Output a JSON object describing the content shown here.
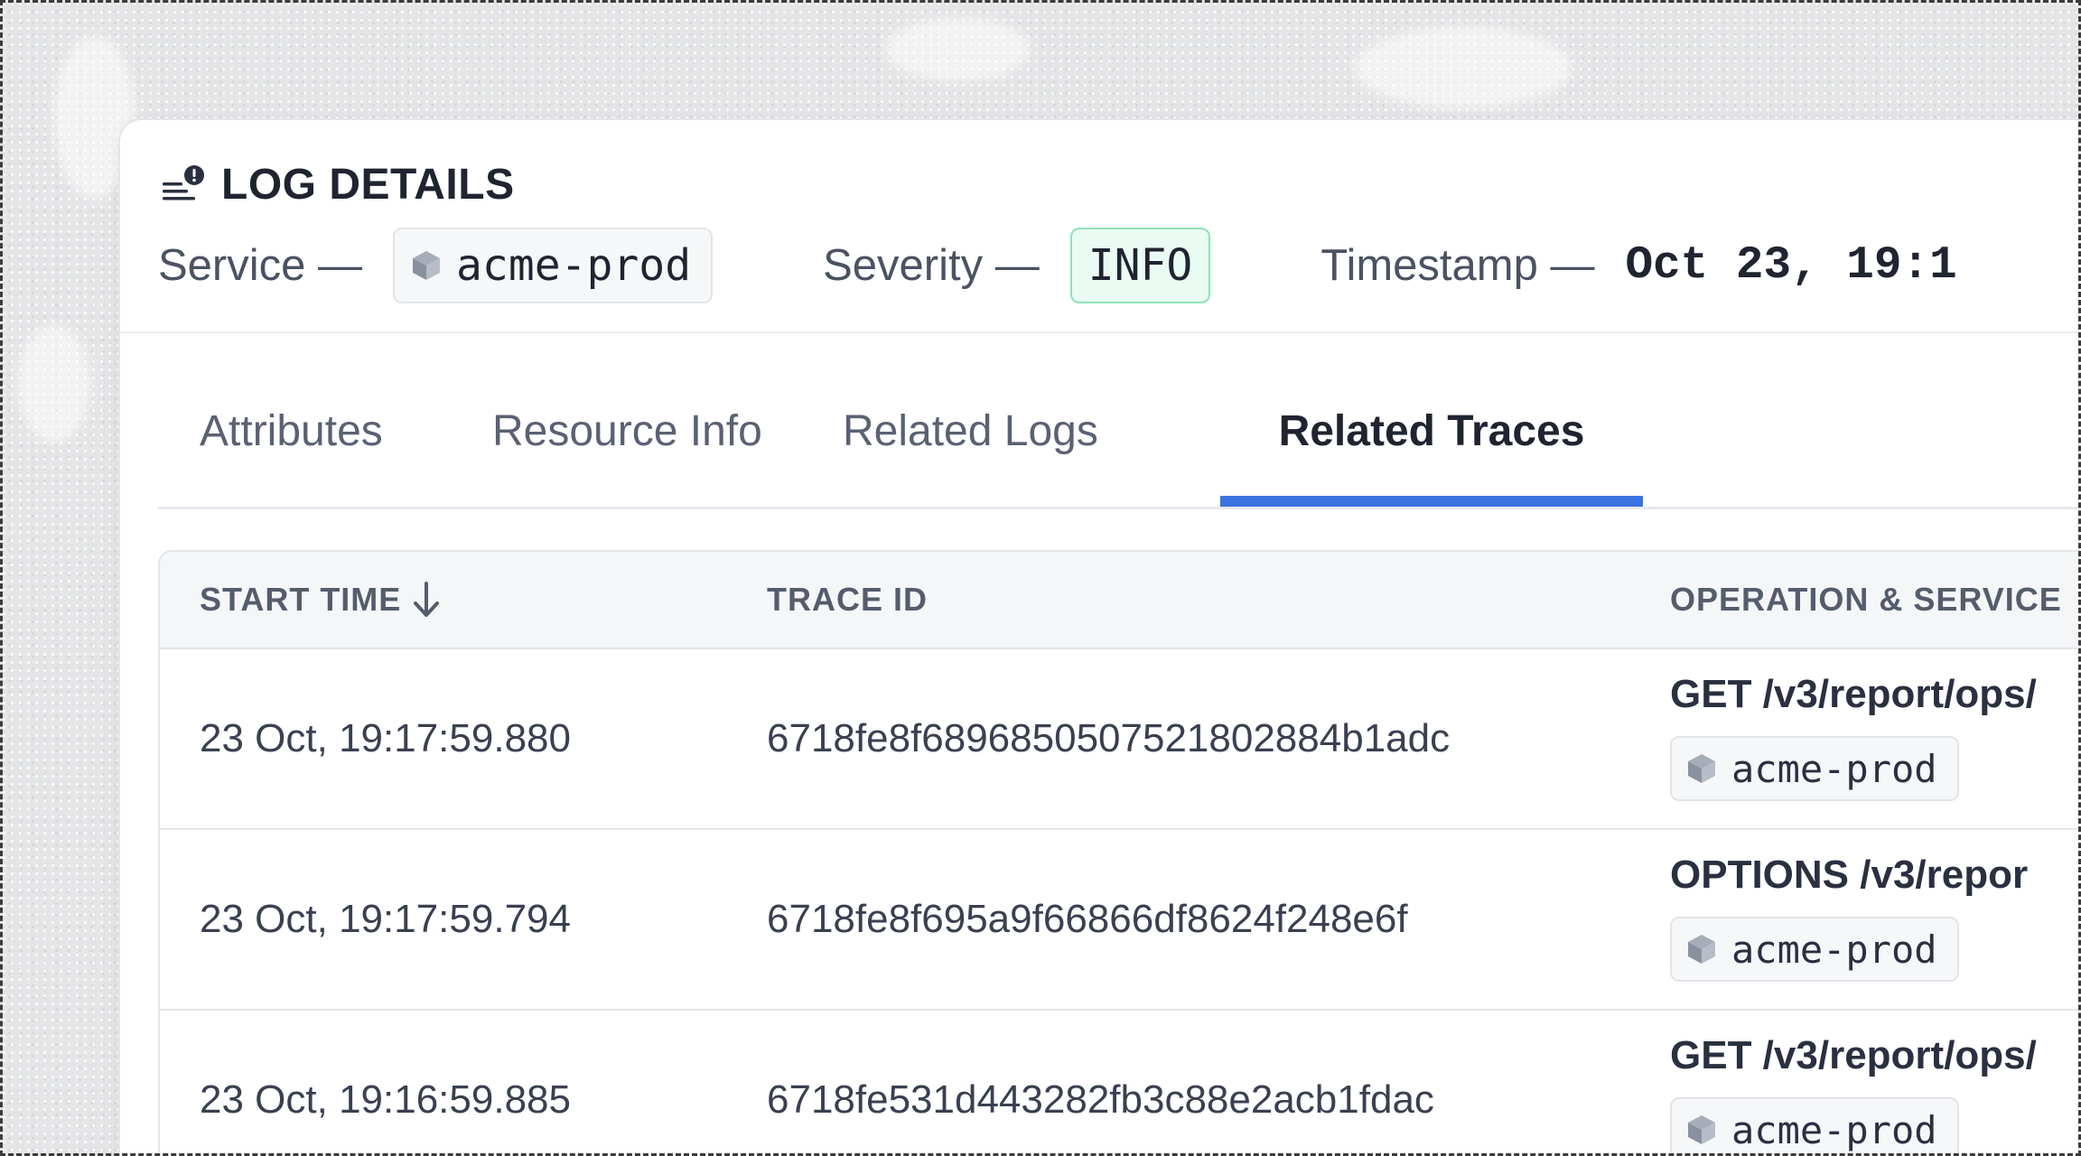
{
  "header": {
    "title": "LOG DETAILS",
    "service_label": "Service —",
    "service_value": "acme-prod",
    "severity_label": "Severity —",
    "severity_value": "INFO",
    "timestamp_label": "Timestamp —",
    "timestamp_value": "Oct 23, 19:1"
  },
  "tabs": [
    {
      "label": "Attributes",
      "active": false
    },
    {
      "label": "Resource Info",
      "active": false
    },
    {
      "label": "Related Logs",
      "active": false
    },
    {
      "label": "Related Traces",
      "active": true
    }
  ],
  "table": {
    "columns": [
      "START TIME",
      "TRACE ID",
      "OPERATION & SERVICE"
    ],
    "rows": [
      {
        "start_time": "23 Oct, 19:17:59.880",
        "trace_id": "6718fe8f6896850507521802884b1adc",
        "operation": "GET /v3/report/ops/",
        "service": "acme-prod"
      },
      {
        "start_time": "23 Oct, 19:17:59.794",
        "trace_id": "6718fe8f695a9f66866df8624f248e6f",
        "operation": "OPTIONS /v3/repor",
        "service": "acme-prod"
      },
      {
        "start_time": "23 Oct, 19:16:59.885",
        "trace_id": "6718fe531d443282fb3c88e2acb1fdac",
        "operation": "GET /v3/report/ops/",
        "service": "acme-prod"
      }
    ]
  },
  "icons": {
    "title": "log-list-alert-icon",
    "service": "cube-icon",
    "sort": "arrow-down-icon"
  },
  "colors": {
    "accent": "#3b74e0",
    "severity_bg": "#e9fbf2",
    "severity_border": "#8ee2b7",
    "panel_bg": "#ffffff",
    "header_bg": "#f5f6f8"
  }
}
